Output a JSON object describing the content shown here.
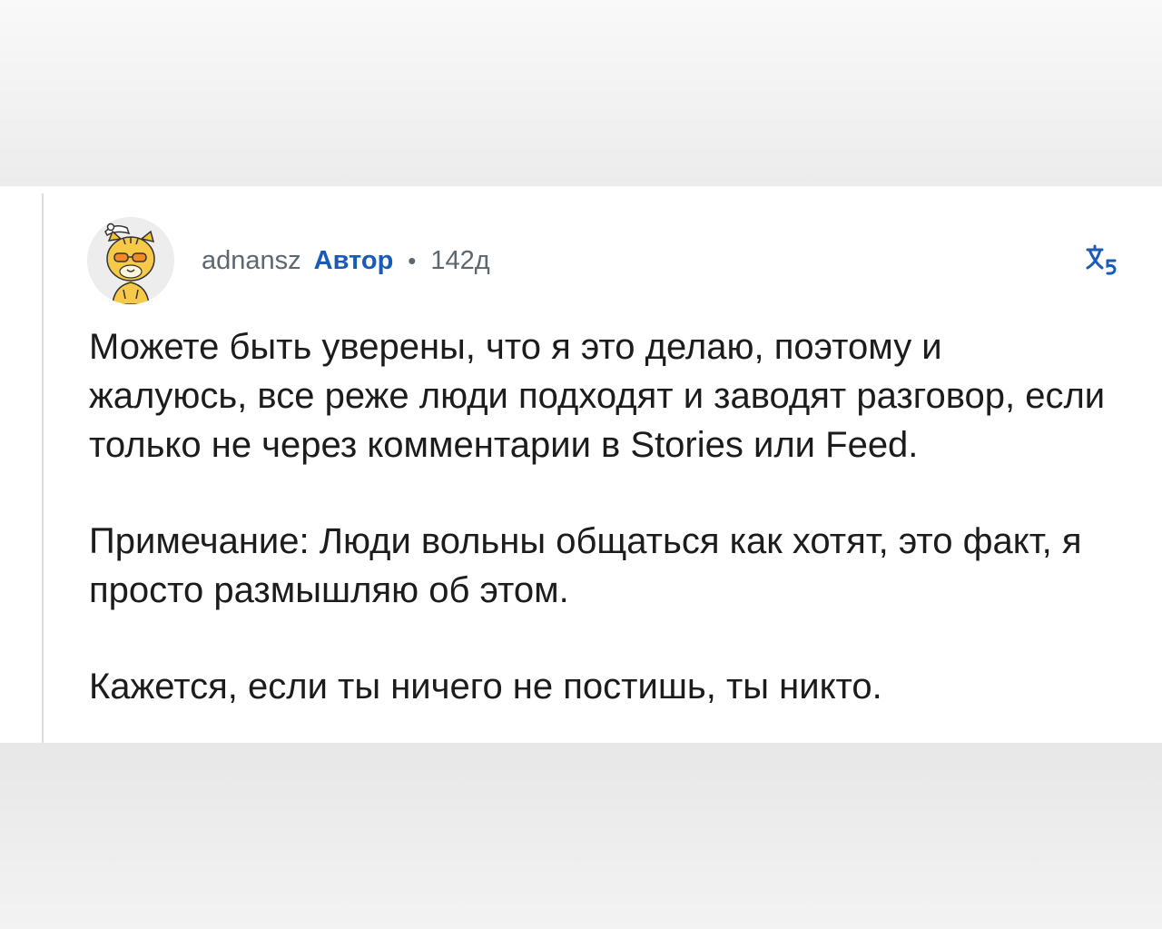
{
  "comment": {
    "username": "adnansz",
    "author_badge": "Автор",
    "separator": "•",
    "age": "142д",
    "avatar": "snoo-avatar-tiger-sunglasses",
    "translate_icon": "translate-icon",
    "paragraphs": [
      "Можете быть уверены, что я это делаю, поэтому и жалуюсь, все реже люди подходят и заводят разговор, если только не через комментарии в Stories или Feed.",
      "Примечание: Люди вольны общаться как хотят, это факт, я просто размышляю об этом.",
      "Кажется, если ты ничего не постишь, ты никто."
    ]
  },
  "colors": {
    "author_badge": "#1a5bb8",
    "meta_text": "#5c6770",
    "body_text": "#1c1c1c",
    "thread_line": "#dcdcdc"
  }
}
